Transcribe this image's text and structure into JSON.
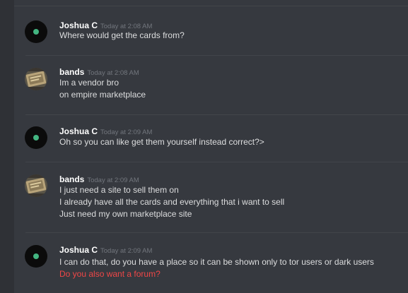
{
  "messages": [
    {
      "author": "Joshua C",
      "avatar_icon": "green-dot-avatar",
      "timestamp": "Today at 2:08 AM",
      "lines": [
        "Where would get the cards from?"
      ]
    },
    {
      "author": "bands",
      "avatar_icon": "image-avatar",
      "timestamp": "Today at 2:08 AM",
      "lines": [
        "Im a vendor bro",
        "on empire marketplace"
      ]
    },
    {
      "author": "Joshua C",
      "avatar_icon": "green-dot-avatar",
      "timestamp": "Today at 2:09 AM",
      "lines": [
        "Oh so you can like get them yourself instead correct?>"
      ]
    },
    {
      "author": "bands",
      "avatar_icon": "image-avatar",
      "timestamp": "Today at 2:09 AM",
      "lines": [
        "I just need a site to sell them on",
        "I already have all the cards and everything that i want to sell",
        "Just need my own marketplace site"
      ]
    },
    {
      "author": "Joshua C",
      "avatar_icon": "green-dot-avatar",
      "timestamp": "Today at 2:09 AM",
      "lines": [
        "I can do that, do you have a place so it can be shown only to tor users or dark users",
        "Do you also want a forum?"
      ]
    }
  ],
  "colors": {
    "background": "#36393f",
    "username": "#ffffff",
    "timestamp": "#72767d",
    "text": "#dcddde",
    "highlight_text": "#f04747",
    "status_dot": "#43b581"
  }
}
